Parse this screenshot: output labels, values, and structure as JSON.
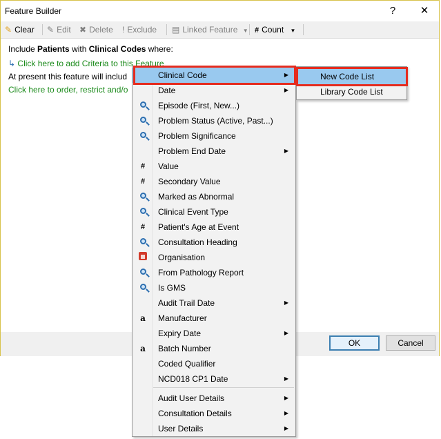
{
  "window": {
    "title": "Feature Builder",
    "help_label": "?",
    "close_label": "✕"
  },
  "toolbar": {
    "clear": "Clear",
    "edit": "Edit",
    "delete": "Delete",
    "exclude": "Exclude",
    "linked_feature": "Linked Feature",
    "count": "Count"
  },
  "content": {
    "include_prefix": "Include",
    "patients": "Patients",
    "with": "with",
    "clinical_codes": "Clinical Codes",
    "where": "where:",
    "add_criteria": "Click here to add Criteria to this Feature",
    "present_text": "At present this feature will includ",
    "order_text": "Click here to order, restrict and/o"
  },
  "footer": {
    "ok": "OK",
    "cancel": "Cancel"
  },
  "menu": {
    "items": [
      {
        "label": "Clinical Code",
        "icon": "none",
        "submenu": true,
        "highlighted": true
      },
      {
        "label": "Date",
        "icon": "none",
        "submenu": true
      },
      {
        "label": "Episode (First, New...)",
        "icon": "magnifier-icon",
        "submenu": false
      },
      {
        "label": "Problem Status (Active, Past...)",
        "icon": "magnifier-icon",
        "submenu": false
      },
      {
        "label": "Problem Significance",
        "icon": "magnifier-icon",
        "submenu": false
      },
      {
        "label": "Problem End Date",
        "icon": "none",
        "submenu": true
      },
      {
        "label": "Value",
        "icon": "hash-icon",
        "submenu": false
      },
      {
        "label": "Secondary Value",
        "icon": "hash-icon",
        "submenu": false
      },
      {
        "label": "Marked as Abnormal",
        "icon": "magnifier-icon",
        "submenu": false
      },
      {
        "label": "Clinical Event Type",
        "icon": "magnifier-icon",
        "submenu": false
      },
      {
        "label": "Patient's Age at Event",
        "icon": "hash-icon",
        "submenu": false
      },
      {
        "label": "Consultation Heading",
        "icon": "magnifier-icon",
        "submenu": false
      },
      {
        "label": "Organisation",
        "icon": "organisation-icon",
        "submenu": false
      },
      {
        "label": "From Pathology Report",
        "icon": "magnifier-icon",
        "submenu": false
      },
      {
        "label": "Is GMS",
        "icon": "magnifier-icon",
        "submenu": false
      },
      {
        "label": "Audit Trail Date",
        "icon": "none",
        "submenu": true
      },
      {
        "label": "Manufacturer",
        "icon": "text-icon",
        "submenu": false
      },
      {
        "label": "Expiry Date",
        "icon": "none",
        "submenu": true
      },
      {
        "label": "Batch Number",
        "icon": "text-icon",
        "submenu": false
      },
      {
        "label": "Coded Qualifier",
        "icon": "none",
        "submenu": false
      },
      {
        "label": "NCD018 CP1 Date",
        "icon": "none",
        "submenu": true
      },
      {
        "label": "Audit User Details",
        "icon": "none",
        "submenu": true
      },
      {
        "label": "Consultation Details",
        "icon": "none",
        "submenu": true
      },
      {
        "label": "User Details",
        "icon": "none",
        "submenu": true
      }
    ]
  },
  "submenu": {
    "items": [
      {
        "label": "New Code List",
        "highlighted": true
      },
      {
        "label": "Library Code List",
        "highlighted": false
      }
    ]
  },
  "colors": {
    "highlight": "#99c9ef",
    "callout_border": "#e52b1e",
    "link_green": "#1a8a1a"
  }
}
